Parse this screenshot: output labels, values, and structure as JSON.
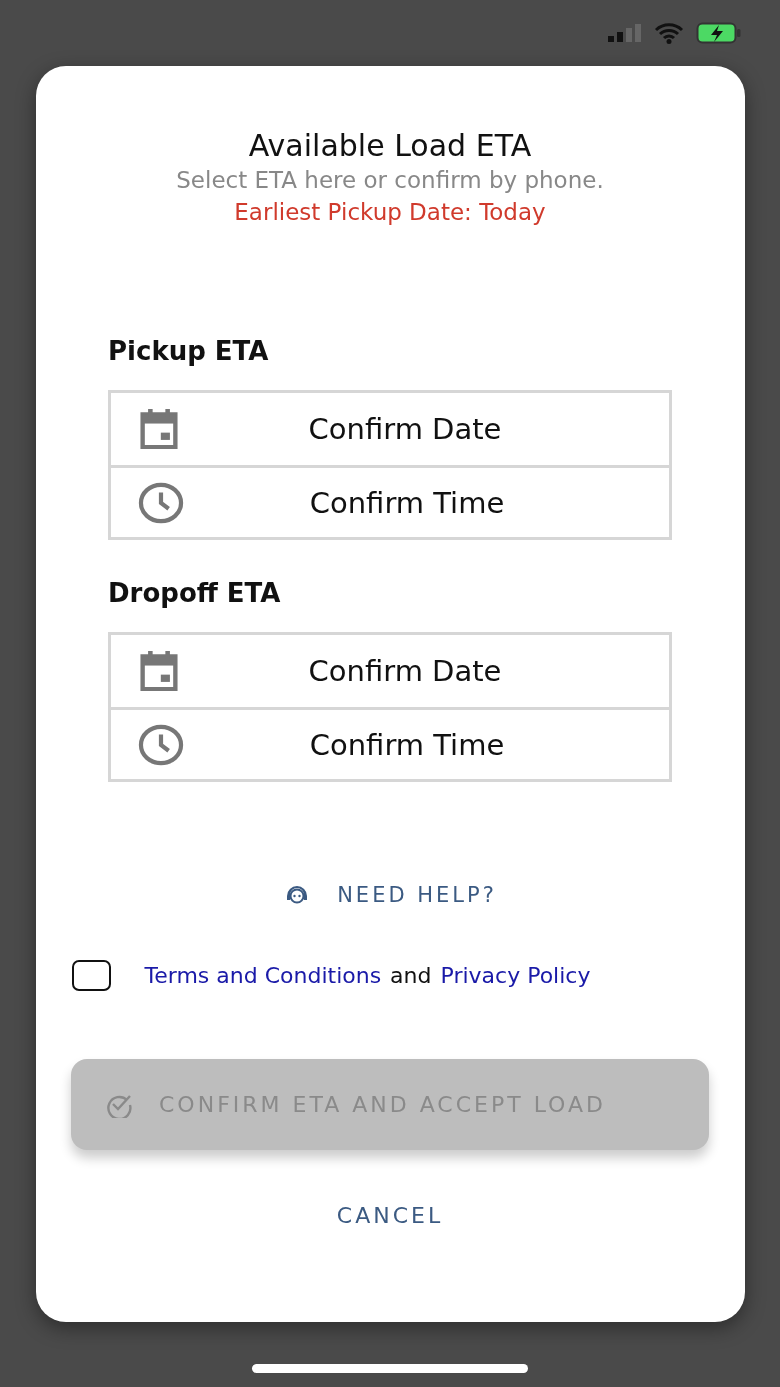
{
  "dialog": {
    "title": "Available Load ETA",
    "subtitle": "Select ETA here or confirm by phone.",
    "notice": "Earliest Pickup Date: Today"
  },
  "sections": [
    {
      "heading": "Pickup ETA",
      "rows": [
        {
          "kind": "date",
          "label": "Confirm Date"
        },
        {
          "kind": "time",
          "label": "Confirm Time"
        }
      ]
    },
    {
      "heading": "Dropoff ETA",
      "rows": [
        {
          "kind": "date",
          "label": "Confirm Date"
        },
        {
          "kind": "time",
          "label": "Confirm Time"
        }
      ]
    }
  ],
  "help_link": "NEED HELP?",
  "agreement": {
    "checked": false,
    "parts": [
      {
        "kind": "link",
        "text": "Terms and Conditions"
      },
      {
        "kind": "text",
        "text": "and"
      },
      {
        "kind": "link",
        "text": "Privacy Policy"
      }
    ]
  },
  "confirm_button": {
    "label": "CONFIRM ETA AND ACCEPT LOAD",
    "disabled": true
  },
  "cancel_button": "CANCEL"
}
